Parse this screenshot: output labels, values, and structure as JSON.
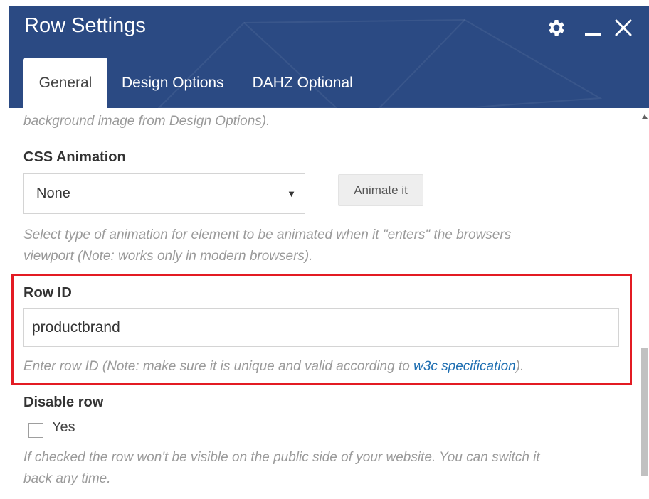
{
  "header": {
    "title": "Row Settings",
    "bg_color": "#2b4a83",
    "icons": [
      "gear-icon",
      "minimize-icon",
      "close-icon"
    ]
  },
  "tabs": [
    {
      "label": "General",
      "active": true
    },
    {
      "label": "Design Options",
      "active": false
    },
    {
      "label": "DAHZ Optional",
      "active": false
    }
  ],
  "background_hint": "background image from Design Options).",
  "css_animation": {
    "label": "CSS Animation",
    "selected": "None",
    "button_label": "Animate it",
    "hint_line1": "Select type of animation for element to be animated when it \"enters\" the browsers",
    "hint_line2": "viewport (Note: works only in modern browsers)."
  },
  "row_id": {
    "label": "Row ID",
    "value": "productbrand",
    "hint_prefix": "Enter row ID (Note: make sure it is unique and valid according to ",
    "hint_link": "w3c specification",
    "hint_suffix": ").",
    "highlight_color": "#e31b23"
  },
  "disable_row": {
    "label": "Disable row",
    "checkbox_label": "Yes",
    "checked": false,
    "hint_line1": "If checked the row won't be visible on the public side of your website. You can switch it",
    "hint_line2": "back any time."
  }
}
